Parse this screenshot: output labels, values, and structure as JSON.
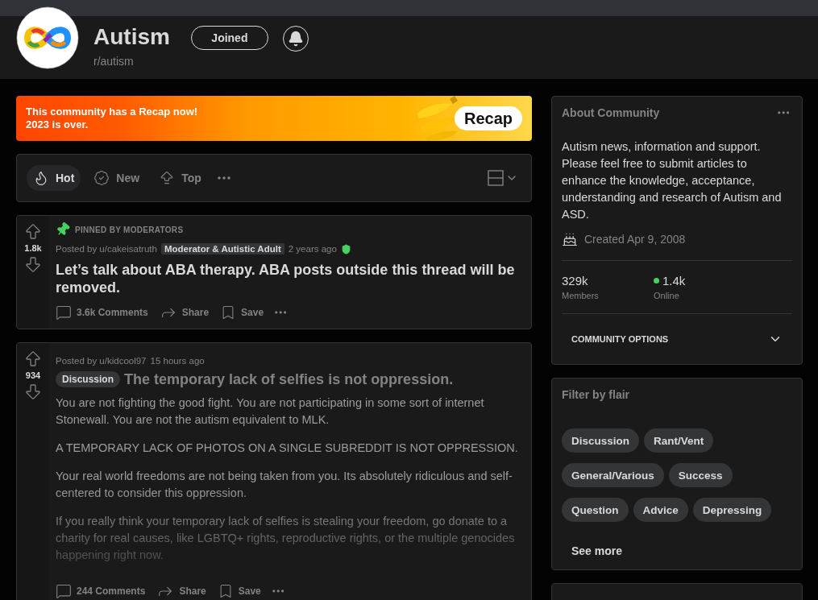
{
  "header": {
    "name": "Autism",
    "subreddit": "r/autism",
    "join_label": "Joined",
    "joined": true
  },
  "banner": {
    "text": "This community has a Recap now!",
    "subtext": "2023 is over.",
    "button": "Recap"
  },
  "sort_tabs": [
    {
      "label": "Hot",
      "selected": true
    },
    {
      "label": "New",
      "selected": false
    },
    {
      "label": "Top",
      "selected": false
    }
  ],
  "posts": [
    {
      "votes": "1.8k",
      "pinned": true,
      "pinned_label": "PINNED BY MODERATORS",
      "posted_by": "Posted by u/cakeisatruth",
      "user_flair": "Moderator & Autistic Adult",
      "time": "2 years ago",
      "moderator": true,
      "title": "Let’s talk about ABA therapy. ABA posts outside this thread will be removed.",
      "comments": "3.6k Comments",
      "share": "Share",
      "save": "Save"
    },
    {
      "votes": "934",
      "pinned": false,
      "posted_by": "Posted by u/kidcool97",
      "time": "15 hours ago",
      "moderator": false,
      "flair": "Discussion",
      "title": "The temporary lack of selfies is not oppression.",
      "comments": "244 Comments",
      "share": "Share",
      "save": "Save",
      "body": [
        "You are not fighting the good fight. You are not participating in some sort of internet Stonewall. You are not the autism equivalent to MLK.",
        "A TEMPORARY LACK OF PHOTOS ON A SINGLE SUBREDDIT IS NOT OPPRESSION.",
        "Your real world freedoms are not being taken from you. Its absolutely ridiculous and self-centered to consider this oppression.",
        "If you really think your temporary lack of selfies is stealing your freedom, go donate to a charity for real causes, like LGBTQ+ rights, reproductive rights, or the multiple genocides happening right now."
      ]
    }
  ],
  "about": {
    "title": "About Community",
    "description": "Autism news, information and support. Please feel free to submit articles to enhance the knowledge, acceptance, understanding and research of Autism and ASD.",
    "created": "Created Apr 9, 2008",
    "members": "329k",
    "members_label": "Members",
    "online": "1.4k",
    "online_label": "Online",
    "options": "COMMUNITY OPTIONS"
  },
  "flair_filter": {
    "title": "Filter by flair",
    "flairs": [
      "Discussion",
      "Rant/Vent",
      "General/Various",
      "Success",
      "Question",
      "Advice",
      "Depressing"
    ],
    "see_more": "See more"
  }
}
